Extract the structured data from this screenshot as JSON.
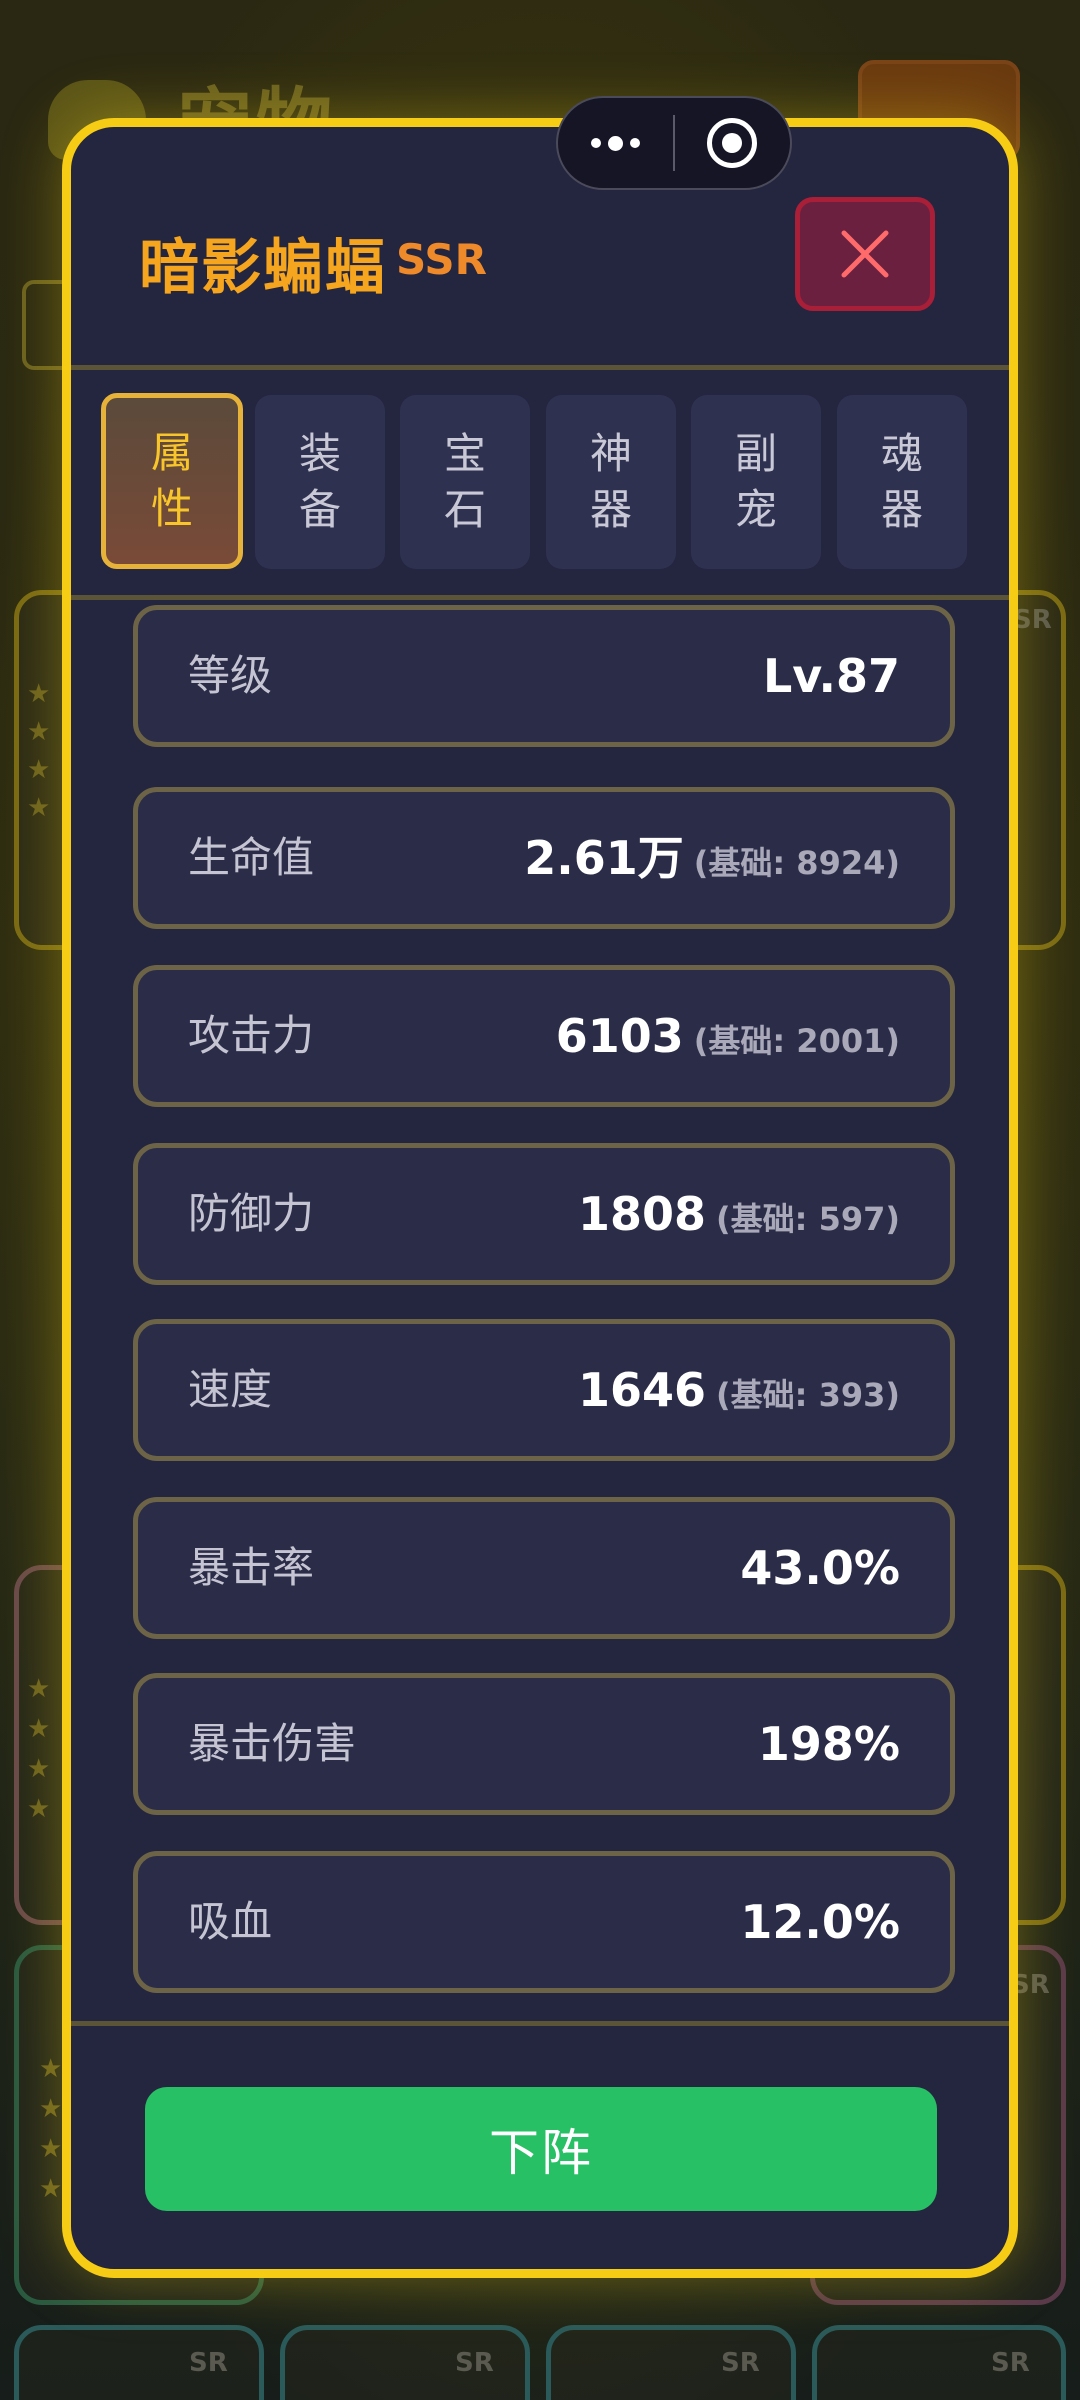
{
  "background": {
    "title": "宠物",
    "card_tags": [
      "SR",
      "SR",
      "SR",
      "SR",
      "SR",
      "SR"
    ],
    "card_stars": "★"
  },
  "capsule": {
    "more_icon": "more-dots-icon",
    "close_icon": "target-icon"
  },
  "modal": {
    "pet_name": "暗影蝙蝠",
    "rarity": "SSR",
    "close_icon": "close-x-icon",
    "tabs": [
      {
        "top": "属",
        "bottom": "性",
        "active": true
      },
      {
        "top": "装",
        "bottom": "备",
        "active": false
      },
      {
        "top": "宝",
        "bottom": "石",
        "active": false
      },
      {
        "top": "神",
        "bottom": "器",
        "active": false
      },
      {
        "top": "副",
        "bottom": "宠",
        "active": false
      },
      {
        "top": "魂",
        "bottom": "器",
        "active": false
      }
    ],
    "stats": [
      {
        "label": "等级",
        "value": "Lv.87",
        "base": ""
      },
      {
        "label": "生命值",
        "value": "2.61万",
        "base": "(基础: 8924)"
      },
      {
        "label": "攻击力",
        "value": "6103",
        "base": "(基础: 2001)"
      },
      {
        "label": "防御力",
        "value": "1808",
        "base": "(基础: 597)"
      },
      {
        "label": "速度",
        "value": "1646",
        "base": "(基础: 393)"
      },
      {
        "label": "暴击率",
        "value": "43.0%",
        "base": ""
      },
      {
        "label": "暴击伤害",
        "value": "198%",
        "base": ""
      },
      {
        "label": "吸血",
        "value": "12.0%",
        "base": ""
      }
    ],
    "action_label": "下阵"
  },
  "colors": {
    "modal_border": "#f7cc15",
    "pet_name": "#f5a51e",
    "rarity": "#ef8a2a",
    "action_button": "#28c064",
    "close_button": "#a81f37"
  }
}
